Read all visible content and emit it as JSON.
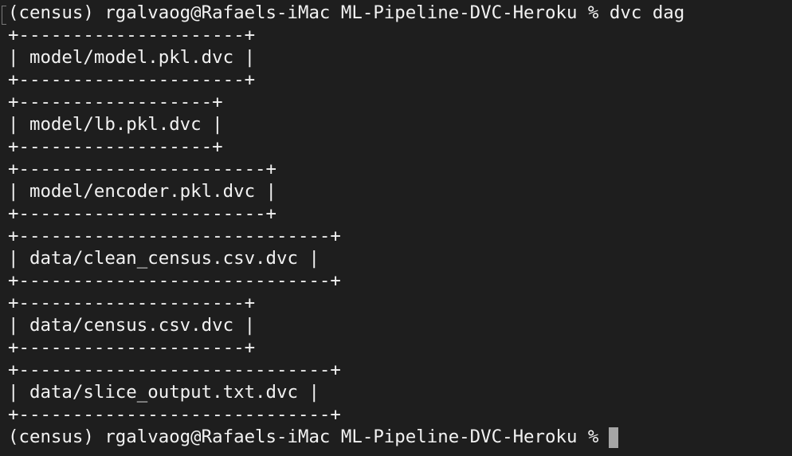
{
  "terminal": {
    "prompt": "(census) rgalvaog@Rafaels-iMac ML-Pipeline-DVC-Heroku %",
    "command": "dvc dag",
    "lines": [
      "+---------------------+",
      "| model/model.pkl.dvc |",
      "+---------------------+",
      "+------------------+",
      "| model/lb.pkl.dvc |",
      "+------------------+",
      "+-----------------------+",
      "| model/encoder.pkl.dvc |",
      "+-----------------------+",
      "+-----------------------------+",
      "| data/clean_census.csv.dvc |",
      "+-----------------------------+",
      "+---------------------+",
      "| data/census.csv.dvc |",
      "+---------------------+",
      "+-----------------------------+",
      "| data/slice_output.txt.dvc |",
      "+-----------------------------+"
    ]
  },
  "colors": {
    "background": "#1e1e1e",
    "text": "#f2f2f2",
    "cursor": "#a6a6a6"
  }
}
